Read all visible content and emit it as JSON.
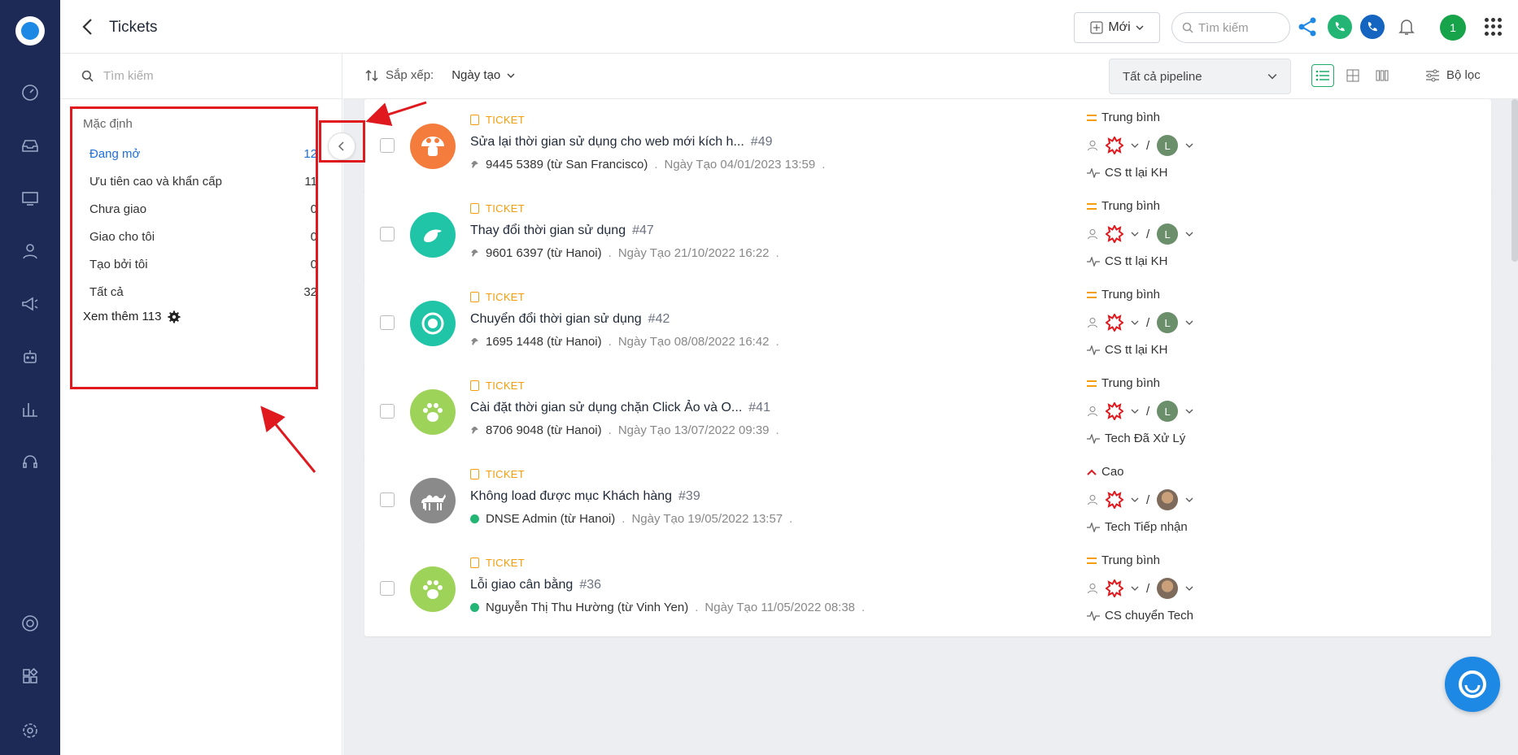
{
  "header": {
    "title": "Tickets",
    "new_label": "Mới",
    "search_placeholder": "Tìm kiếm",
    "avatar_initial": "1"
  },
  "left_panel": {
    "search_placeholder": "Tìm kiếm",
    "group_title": "Mặc định",
    "items": [
      {
        "label": "Đang mở",
        "count": "12",
        "active": true
      },
      {
        "label": "Ưu tiên cao và khẩn cấp",
        "count": "11"
      },
      {
        "label": "Chưa giao",
        "count": "0"
      },
      {
        "label": "Giao cho tôi",
        "count": "0"
      },
      {
        "label": "Tạo bởi tôi",
        "count": "0"
      },
      {
        "label": "Tất cả",
        "count": "32"
      }
    ],
    "see_more": "Xem thêm 113"
  },
  "toolbar": {
    "sort_label": "Sắp xếp:",
    "sort_value": "Ngày tạo",
    "pipeline": "Tất cả pipeline",
    "filter_label": "Bộ lọc"
  },
  "tickets": [
    {
      "tag": "TICKET",
      "title": "Sửa lại thời gian sử dụng cho web mới kích h...",
      "num": "#49",
      "contact": "9445 5389 (từ San Francisco)",
      "date": "Ngày Tạo 04/01/2023 13:59",
      "priority": "Trung bình",
      "assignee": "L",
      "status": "CS tt lại KH",
      "avatar_color": "#f47c3c",
      "avatar_icon": "mushroom-icon",
      "contact_icon": "pin-icon"
    },
    {
      "tag": "TICKET",
      "title": "Thay đổi thời gian sử dụng",
      "num": "#47",
      "contact": "9601 6397 (từ Hanoi)",
      "date": "Ngày Tạo 21/10/2022 16:22",
      "priority": "Trung bình",
      "assignee": "L",
      "status": "CS tt lại KH",
      "avatar_color": "#1fc5a6",
      "avatar_icon": "bird-icon",
      "contact_icon": "pin-icon"
    },
    {
      "tag": "TICKET",
      "title": "Chuyển đổi thời gian sử dụng",
      "num": "#42",
      "contact": "1695 1448 (từ Hanoi)",
      "date": "Ngày Tạo 08/08/2022 16:42",
      "priority": "Trung bình",
      "assignee": "L",
      "status": "CS tt lại KH",
      "avatar_color": "#1fc5a6",
      "avatar_icon": "astronaut-icon",
      "contact_icon": "pin-icon"
    },
    {
      "tag": "TICKET",
      "title": "Cài đặt thời gian sử dụng chặn Click Ảo và O...",
      "num": "#41",
      "contact": "8706 9048 (từ Hanoi)",
      "date": "Ngày Tạo 13/07/2022 09:39",
      "priority": "Trung bình",
      "assignee": "L",
      "status": "Tech Đã Xử Lý",
      "avatar_color": "#9ed35a",
      "avatar_icon": "paw-icon",
      "contact_icon": "pin-icon"
    },
    {
      "tag": "TICKET",
      "title": "Không load được mục Khách hàng",
      "num": "#39",
      "contact": "DNSE Admin (từ Hanoi)",
      "date": "Ngày Tạo 19/05/2022 13:57",
      "priority": "Cao",
      "assignee": "",
      "status": "Tech Tiếp nhận",
      "avatar_color": "#8a8a8a",
      "avatar_icon": "camel-icon",
      "contact_icon": "online-dot-icon"
    },
    {
      "tag": "TICKET",
      "title": "Lỗi giao cân bằng",
      "num": "#36",
      "contact": "Nguyễn Thị Thu Hường (từ Vinh Yen)",
      "date": "Ngày Tạo 11/05/2022 08:38",
      "priority": "Trung bình",
      "assignee": "",
      "status": "CS chuyển Tech",
      "avatar_color": "#9ed35a",
      "avatar_icon": "paw-icon",
      "contact_icon": "online-dot-icon"
    }
  ],
  "colors": {
    "rail": "#1d2a55",
    "accent_blue": "#1e6fd9",
    "ticket_tag": "#f59e0b",
    "priority_high": "#e0191e",
    "annotation_red": "#e0191e"
  }
}
